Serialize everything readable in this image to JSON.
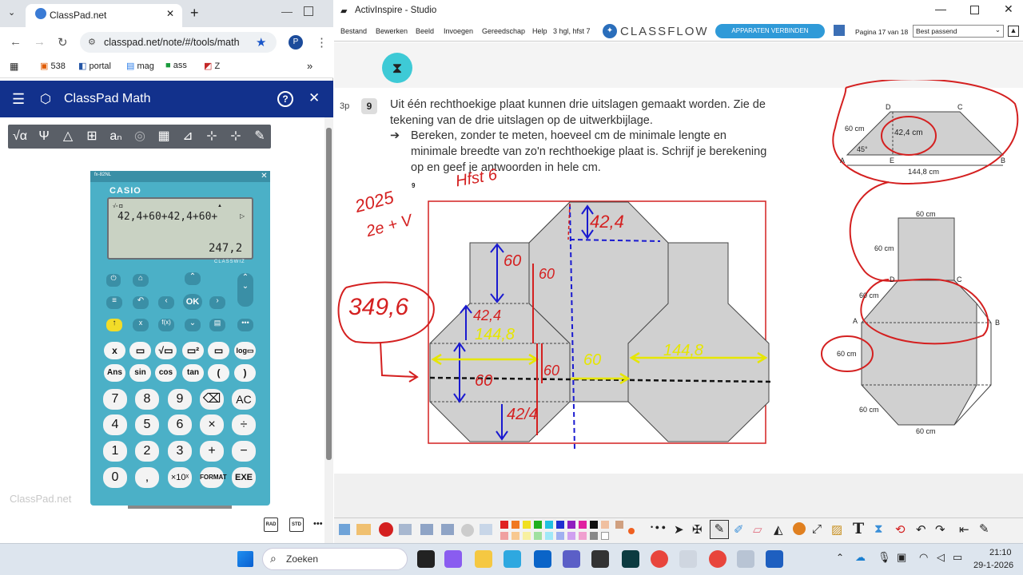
{
  "browser": {
    "tab_title": "ClassPad.net",
    "url": "classpad.net/note/#/tools/math",
    "profile_initial": "P",
    "bookmarks": [
      "538",
      "portal",
      "mag",
      "ass",
      "Z"
    ]
  },
  "classpad": {
    "title": "ClassPad Math",
    "help": "?",
    "close": "✕",
    "tools": [
      "√α",
      "Ψ",
      "△",
      "⊞",
      "aₙ",
      "◎",
      "▦",
      "⊿",
      "⊹",
      "✎"
    ],
    "calc": {
      "model": "fx-82NL",
      "brand": "CASIO",
      "series": "CLASSWIZ",
      "input": "42,4+60+42,4+60+",
      "result": "247,2",
      "watermark": "ClassPad.net",
      "row_keys": [
        [
          "x",
          "▭",
          "√▭",
          "▭²",
          "▭",
          "log▭"
        ],
        [
          "Ans",
          "sin",
          "cos",
          "tan",
          "(",
          ")"
        ]
      ],
      "num_keys": [
        [
          "7",
          "8",
          "9",
          "⌫",
          "AC"
        ],
        [
          "4",
          "5",
          "6",
          "×",
          "÷"
        ],
        [
          "1",
          "2",
          "3",
          "+",
          "−"
        ],
        [
          "0",
          ",",
          "×10ˣ",
          "FORMAT",
          "EXE"
        ]
      ],
      "nav_ok": "OK"
    },
    "footer_buttons": [
      "RAD",
      "STD",
      "•••"
    ]
  },
  "activinspire": {
    "title": "ActivInspire - Studio",
    "menu": [
      "Bestand",
      "Bewerken",
      "Beeld",
      "Invoegen",
      "Gereedschap",
      "Help"
    ],
    "doc_name": "3 hgl, hfst 7",
    "classflow": "CLASSFLOW",
    "connect_button": "APPARATEN VERBINDEN",
    "page_label": "Pagina 17 van 18",
    "zoom": "Best passend"
  },
  "exercise": {
    "points": "3p",
    "number": "9",
    "text_line1": "Uit één rechthoekige plaat kunnen drie uitslagen gemaakt worden. Zie de",
    "text_line2": "tekening van de drie uitslagen op de uitwerkbijlage.",
    "bullet_line1": "Bereken, zonder te meten, hoeveel cm de minimale lengte en",
    "bullet_line2": "minimale breedte van zo'n rechthoekige plaat is. Schrijf je berekening",
    "bullet_line3": "op en geef je antwoorden in hele cm.",
    "small_9": "9",
    "trapezoid": {
      "D": "D",
      "C": "C",
      "A": "A",
      "E": "E",
      "B": "B",
      "side": "60 cm",
      "height": "42,4 cm",
      "angle": "45°",
      "base": "144,8 cm"
    },
    "net": {
      "top": "60 cm",
      "side": "60 cm",
      "D": "D",
      "C": "C",
      "A": "A",
      "B": "B",
      "left1": "60 cm",
      "left2": "60 cm",
      "left3": "60 cm",
      "bottom": "60 cm"
    }
  },
  "annotations": {
    "year": "2025",
    "hfst": "Hfst 6",
    "class": "2e + V",
    "total": "349,6",
    "v42a": "42,4",
    "v60a": "60",
    "v60b": "60",
    "v42b": "42,4",
    "v144a": "144,8",
    "v60c": "60",
    "v42c": "42/4",
    "v60d": "60",
    "v60e": "60",
    "v144b": "144,8"
  },
  "taskbar": {
    "search": "Zoeken",
    "time": "21:10",
    "date": "29-1-2026"
  }
}
